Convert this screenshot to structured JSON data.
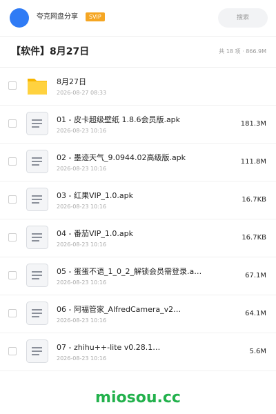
{
  "header": {
    "share_name": "夸克网盘分享",
    "badge": "SVIP",
    "search_placeholder": "搜索",
    "avatar_color": "#2f7bf5",
    "badge_color": "#f5a623"
  },
  "folder": {
    "title": "【软件】8月27日",
    "stats": "共 18 项 · 866.9M"
  },
  "files": [
    {
      "type": "folder",
      "icon": "folder-icon",
      "name": "8月27日",
      "date": "2026-08-27 08:33",
      "size": ""
    },
    {
      "type": "file",
      "icon": "document-icon",
      "name": "01 - 皮卡超级壁纸 1.8.6会员版.apk",
      "date": "2026-08-23 10:16",
      "size": "181.3M"
    },
    {
      "type": "file",
      "icon": "document-icon",
      "name": "02 - 墨迹天气_9.0944.02高级版.apk",
      "date": "2026-08-23 10:16",
      "size": "111.8M"
    },
    {
      "type": "file",
      "icon": "document-icon",
      "name": "03 - 红果VIP_1.0.apk",
      "date": "2026-08-23 10:16",
      "size": "16.7KB"
    },
    {
      "type": "file",
      "icon": "document-icon",
      "name": "04 - 番茄VIP_1.0.apk",
      "date": "2026-08-23 10:16",
      "size": "16.7KB"
    },
    {
      "type": "file",
      "icon": "document-icon",
      "name": "05 - 蛋蛋不语_1_0_2_解锁会员需登录.a…",
      "date": "2026-08-23 10:16",
      "size": "67.1M"
    },
    {
      "type": "file",
      "icon": "document-icon",
      "name": "06 - 阿福管家_AlfredCamera_v2…",
      "date": "2026-08-23 10:16",
      "size": "64.1M"
    },
    {
      "type": "file",
      "icon": "document-icon",
      "name": "07 - zhihu++-lite v0.28.1…",
      "date": "2026-08-23 10:16",
      "size": "5.6M"
    }
  ],
  "watermark": "miosou.cc"
}
